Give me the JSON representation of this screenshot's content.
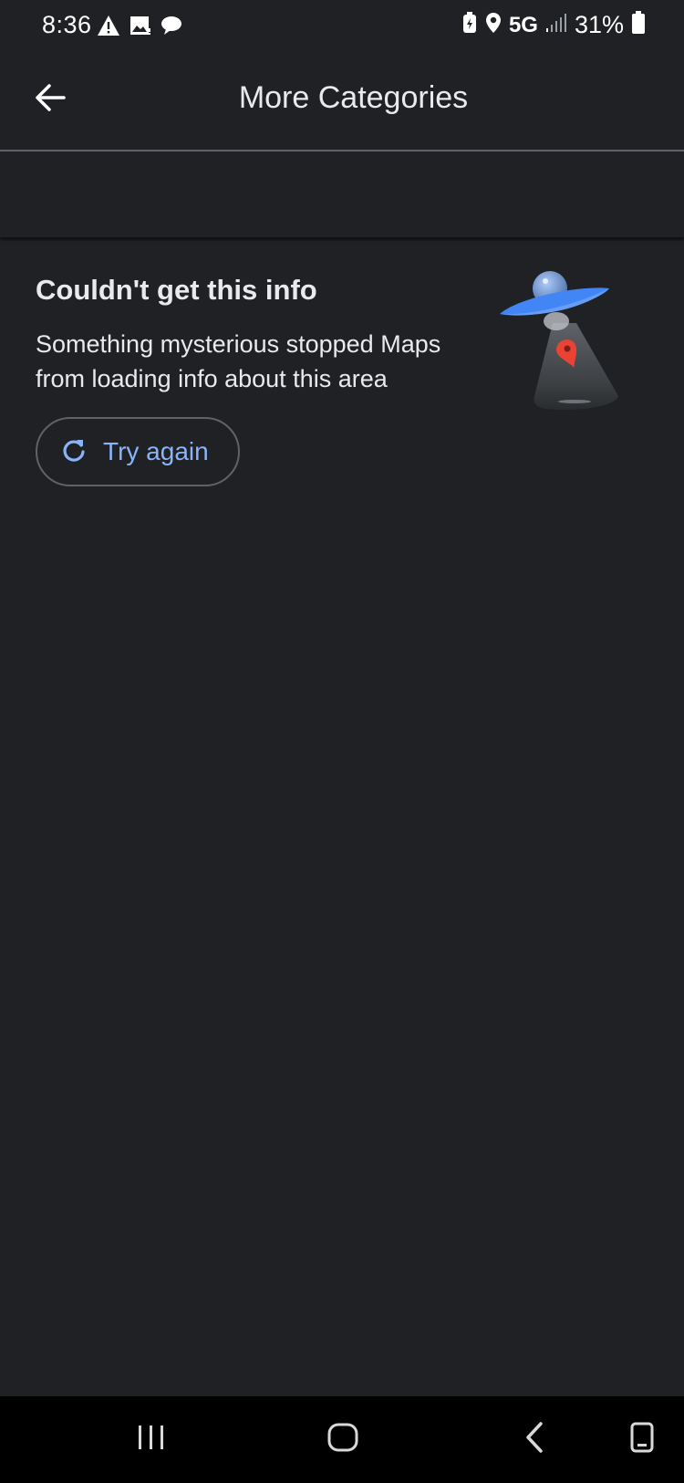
{
  "status_bar": {
    "time": "8:36",
    "network": "5G",
    "battery": "31%"
  },
  "app_bar": {
    "title": "More Categories",
    "icons": {
      "back": "arrow-left-icon"
    }
  },
  "error": {
    "heading": "Couldn't get this info",
    "message": "Something mysterious stopped Maps from loading info about this area",
    "retry_label": "Try again",
    "icons": {
      "retry": "refresh-icon",
      "illustration": "ufo-illustration"
    }
  },
  "nav_bar": {
    "icons": [
      "recent-apps-icon",
      "home-icon",
      "back-icon",
      "screenshot-icon"
    ]
  },
  "colors": {
    "background": "#202124",
    "text": "#e8eaed",
    "accent": "#8ab4f8",
    "divider": "#5f6368",
    "ufo_blue": "#4285f4",
    "pin_red": "#ea4335"
  }
}
